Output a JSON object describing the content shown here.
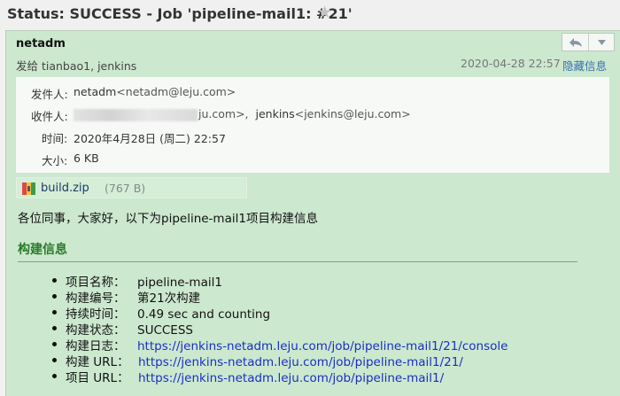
{
  "header": {
    "subject": "Status: SUCCESS - Job 'pipeline-mail1: #21'",
    "star_icon": "star-icon"
  },
  "message": {
    "sender_name": "netadm",
    "recipients_line": "发给 tianbao1, jenkins",
    "date": "2020-04-28 22:57",
    "hide_details_label": "隐藏信息",
    "reply_icon": "reply-icon",
    "more_icon": "chevron-down-icon"
  },
  "details": {
    "from_label": "发件人:",
    "from_name": "netadm",
    "from_email": "<netadm@leju.com>",
    "to_label": "收件人:",
    "to_visible_fragment": "ju.com>,",
    "to_name2": "jenkins",
    "to_email2": "<jenkins@leju.com>",
    "time_label": "时间:",
    "time_value": "2020年4月28日 (周二) 22:57",
    "size_label": "大小:",
    "size_value": "6 KB"
  },
  "attachment": {
    "name": "build.zip",
    "size": "(767 B)",
    "icon": "zip-file-icon"
  },
  "body": {
    "greeting": "各位同事，大家好，以下为pipeline-mail1项目构建信息",
    "section_title": "构建信息",
    "items": [
      {
        "key": "项目名称：",
        "value": "pipeline-mail1",
        "is_link": false
      },
      {
        "key": "构建编号：",
        "value": "第21次构建",
        "is_link": false
      },
      {
        "key": "持续时间：",
        "value": "0.49 sec and counting",
        "is_link": false
      },
      {
        "key": "构建状态：",
        "value": "SUCCESS",
        "is_link": false
      },
      {
        "key": "构建日志：",
        "value": "https://jenkins-netadm.leju.com/job/pipeline-mail1/21/console",
        "is_link": true
      },
      {
        "key": "构建 URL：",
        "value": "https://jenkins-netadm.leju.com/job/pipeline-mail1/21/",
        "is_link": true
      },
      {
        "key": "项目 URL：",
        "value": "https://jenkins-netadm.leju.com/job/pipeline-mail1/",
        "is_link": true
      }
    ]
  },
  "colors": {
    "mail_background": "#cce8cf",
    "details_background": "#f7f9f7",
    "section_title": "#2a7a2a",
    "link": "#1a2fc4"
  }
}
